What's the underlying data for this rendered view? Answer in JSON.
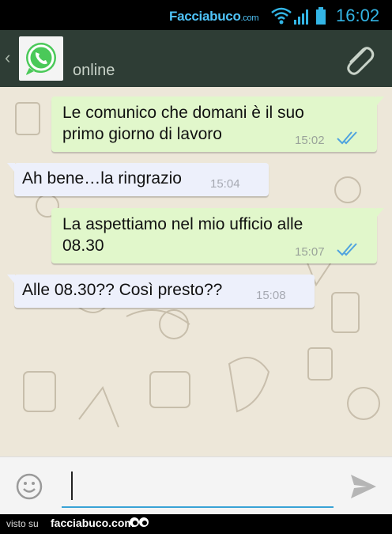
{
  "status_bar": {
    "brand_main": "Facciabuco",
    "brand_suffix": ".com",
    "time": "16:02"
  },
  "header": {
    "contact_status": "online",
    "avatar_icon": "whatsapp-logo",
    "attach_icon": "paperclip-icon"
  },
  "messages": [
    {
      "direction": "out",
      "text_line1": "Le comunico che domani è il suo",
      "text_line2": "primo giorno di lavoro",
      "time": "15:02",
      "read": true
    },
    {
      "direction": "in",
      "text": "Ah bene…la ringrazio",
      "time": "15:04"
    },
    {
      "direction": "out",
      "text_line1": "La aspettiamo nel mio ufficio alle",
      "text_line2": "08.30",
      "time": "15:07",
      "read": true
    },
    {
      "direction": "in",
      "text": "Alle 08.30?? Così presto??",
      "time": "15:08"
    }
  ],
  "composer": {
    "value": "",
    "emoji_icon": "smiley-icon",
    "send_icon": "send-icon"
  },
  "footer": {
    "visto": "visto su",
    "site": "facciabuco.com"
  },
  "colors": {
    "outgoing_bubble": "#e1f7cb",
    "incoming_bubble": "#edf0fb",
    "read_ticks": "#4fa3df",
    "header_bg": "#2e3d35",
    "chat_bg": "#ede7d9"
  }
}
